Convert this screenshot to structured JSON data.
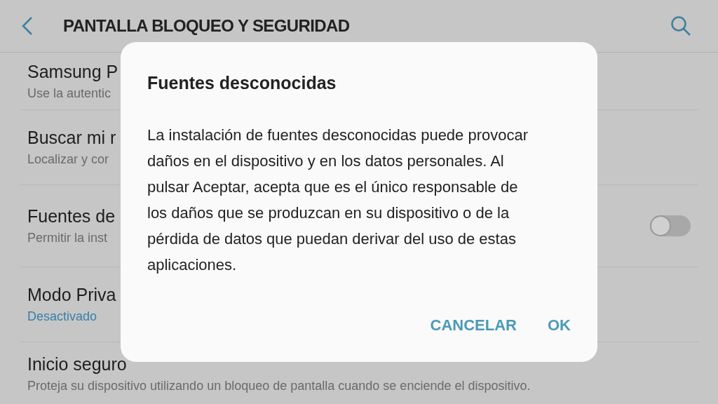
{
  "header": {
    "title": "PANTALLA BLOQUEO Y SEGURIDAD"
  },
  "settings": [
    {
      "kind": "plain",
      "title": "Samsung P",
      "subtitle": "Use la autentic"
    },
    {
      "kind": "plain",
      "title": "Buscar mi r",
      "subtitle": "Localizar y cor"
    },
    {
      "kind": "plain",
      "title": "Fuentes de",
      "subtitle": "Permitir la inst",
      "toggle": {
        "on": false
      }
    },
    {
      "kind": "status",
      "title": "Modo Priva",
      "subtitle": "Desactivado"
    },
    {
      "kind": "plain",
      "title": "Inicio seguro",
      "subtitle": "Proteja su dispositivo utilizando un bloqueo de pantalla cuando se enciende el dispositivo."
    }
  ],
  "dialog": {
    "title": "Fuentes desconocidas",
    "message": "La instalación de fuentes desconocidas puede provocar daños en el dispositivo y en los datos personales. Al pulsar Aceptar, acepta que es el único responsable de los daños que se produzcan en su dispositivo o de la pérdida de datos que puedan derivar del uso de estas aplicaciones.",
    "buttons": [
      "CANCELAR",
      "OK"
    ]
  }
}
